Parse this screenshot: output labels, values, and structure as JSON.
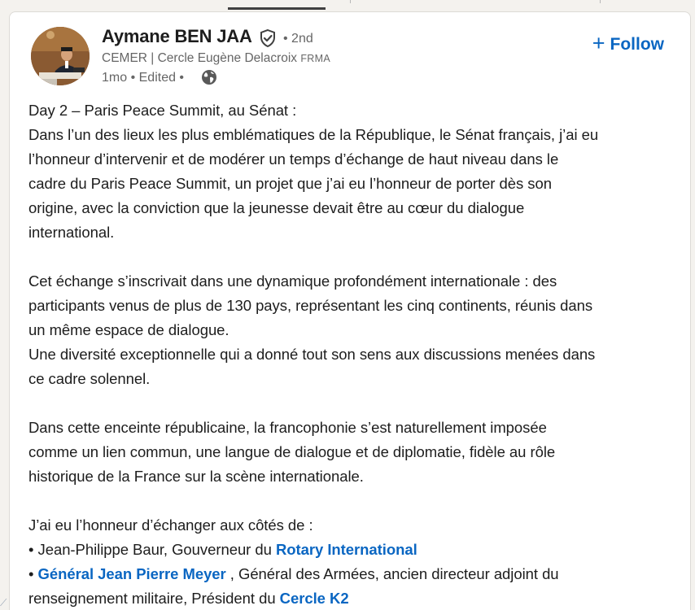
{
  "post": {
    "author": {
      "name": "Aymane BEN JAA",
      "degree": "• 2nd",
      "headline": "CEMER | Cercle Eugène Delacroix",
      "headline_suffix": "FRMA",
      "meta": "1mo • Edited •"
    },
    "follow_label": "Follow",
    "follow_plus": "+",
    "body": {
      "p1": [
        "Day 2 – Paris Peace Summit, au Sénat :",
        "Dans l’un des lieux les plus emblématiques de la République, le Sénat français, j’ai eu",
        "l’honneur d’intervenir et de modérer un temps d’échange de haut niveau dans le",
        "cadre du Paris Peace Summit, un projet que j’ai eu l’honneur de porter dès son",
        "origine, avec la conviction que la jeunesse devait être au cœur du dialogue",
        "international."
      ],
      "p2": [
        "Cet échange s’inscrivait dans une dynamique profondément internationale : des",
        "participants venus de plus de 130 pays, représentant les cinq continents, réunis dans",
        "un même espace de dialogue.",
        "Une diversité exceptionnelle qui a donné tout son sens aux discussions menées dans",
        "ce cadre solennel."
      ],
      "p3": [
        "Dans cette enceinte républicaine, la francophonie s’est naturellement imposée",
        "comme un lien commun, une langue de dialogue et de diplomatie, fidèle au rôle",
        "historique de la France sur la scène internationale."
      ],
      "p4_intro": "J’ai eu l’honneur d’échanger aux côtés de :",
      "bullet1_prefix": "• Jean-Philippe Baur, Gouverneur du ",
      "bullet1_link": "Rotary International",
      "bullet2_prefix": "• ",
      "bullet2_link": "Général Jean Pierre Meyer",
      "bullet2_suffix": " , Général des Armées, ancien directeur adjoint du",
      "bullet2_line2_prefix": "renseignement militaire, Président du ",
      "bullet2_line2_link": "Cercle K2"
    }
  },
  "colors": {
    "link": "#0a66c2",
    "text": "#1d1d1d",
    "muted": "#666666",
    "background": "#f4f2ee"
  },
  "icons": {
    "verified": "verified-shield-icon",
    "globe": "globe-icon",
    "plus": "plus-icon"
  }
}
